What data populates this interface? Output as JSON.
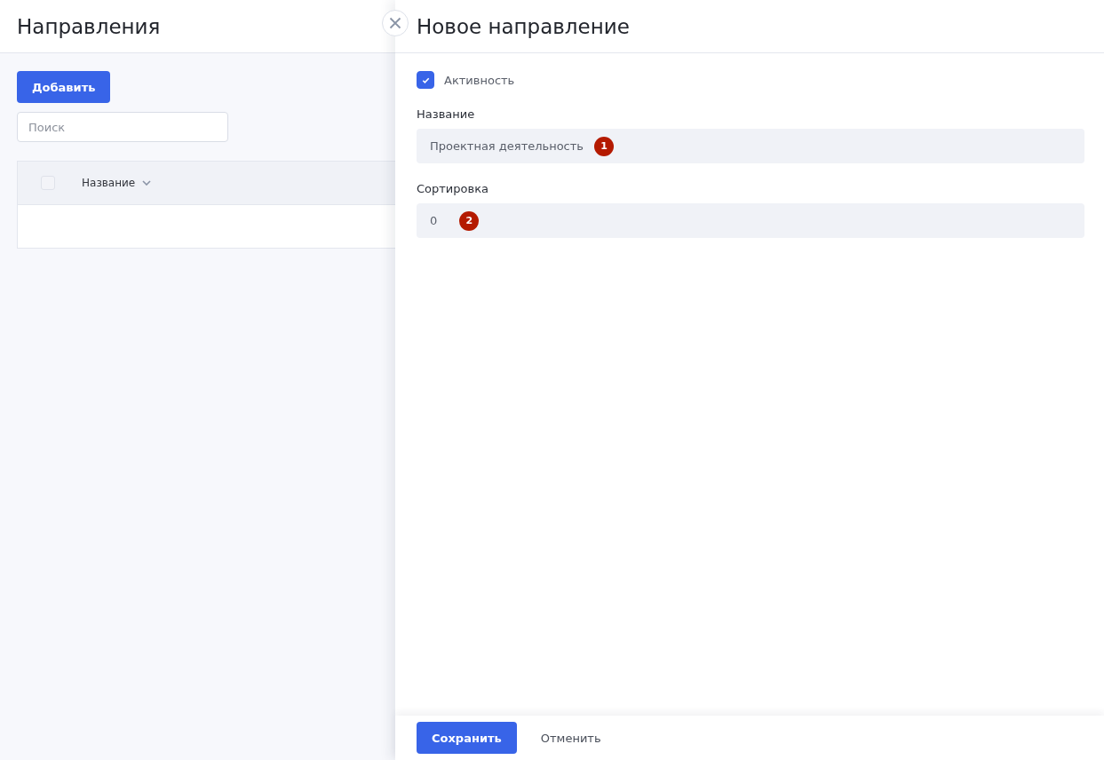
{
  "page": {
    "title": "Направления",
    "add_button": "Добавить",
    "search": {
      "placeholder": "Поиск"
    },
    "table": {
      "select_all": {
        "checked": false
      },
      "columns": [
        {
          "label": "Название",
          "sortable": true
        }
      ]
    }
  },
  "drawer": {
    "title": "Новое направление",
    "fields": [
      {
        "kind": "checkbox",
        "label": "Активность",
        "checked": true
      },
      {
        "kind": "text",
        "label": "Название",
        "value": "Проектная деятельность",
        "marker": "1"
      },
      {
        "kind": "text",
        "label": "Сортировка",
        "value": "0",
        "marker": "2"
      }
    ],
    "buttons": [
      {
        "label": "Сохранить",
        "kind": "primary"
      },
      {
        "label": "Отменить",
        "kind": "link"
      }
    ]
  }
}
